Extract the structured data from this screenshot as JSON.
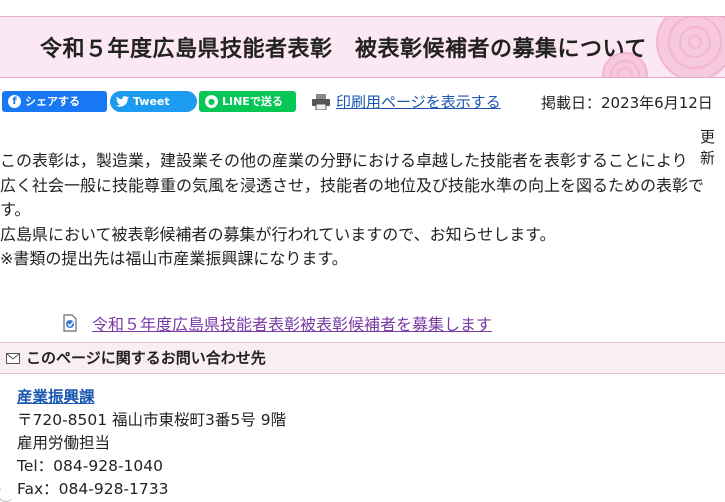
{
  "page": {
    "title": "令和５年度広島県技能者表彰　被表彰候補者の募集について"
  },
  "share": {
    "facebook_label": "シェアする",
    "twitter_label": "Tweet",
    "line_label": "LINEで送る",
    "print_label": "印刷用ページを表示する",
    "date_label": "掲載日：2023年6月12日",
    "update_label": "更新"
  },
  "body": {
    "paragraphs": [
      "この表彰は，製造業，建設業その他の産業の分野における卓越した技能者を表彰することにより",
      "広く社会一般に技能尊重の気風を浸透させ，技能者の地位及び技能水準の向上を図るための表彰です。",
      "広島県において被表彰候補者の募集が行われていますので、お知らせします。",
      "※書類の提出先は福山市産業振興課になります。"
    ],
    "doc_link": "令和５年度広島県技能者表彰被表彰候補者を募集します"
  },
  "contact": {
    "heading": "このページに関するお問い合わせ先",
    "dept": "産業振興課",
    "address": "〒720-8501 福山市東桜町3番5号 9階",
    "section": "雇用労働担当",
    "tel": "Tel：084-928-1040",
    "fax": "Fax：084-928-1733"
  },
  "colors": {
    "facebook": "#1877f2",
    "twitter": "#1d9bf0",
    "line": "#06c755",
    "link": "#1a57b0",
    "visited_link": "#7a3aa5",
    "title_bg": "#fce8f2"
  }
}
